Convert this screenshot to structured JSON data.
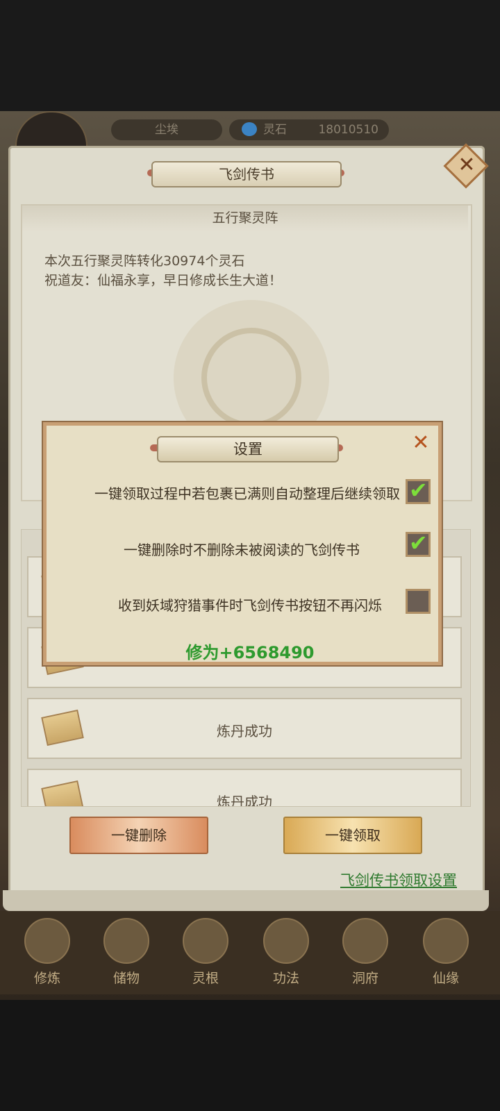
{
  "resources": {
    "dust_label": "尘埃",
    "stone_label": "灵石",
    "stone_value": "18010510"
  },
  "panel": {
    "title": "飞剑传书",
    "mail_subject": "五行聚灵阵",
    "mail_line1": "本次五行聚灵阵转化30974个灵石",
    "mail_line2": "祝道友：仙福永享，早日修成长生大道！"
  },
  "list": {
    "items": [
      {
        "label": "炼丹成功"
      },
      {
        "label": "炼丹成功"
      }
    ]
  },
  "buttons": {
    "delete_all": "一键删除",
    "collect_all": "一键领取",
    "settings_link": "飞剑传书领取设置"
  },
  "nav": {
    "items": [
      {
        "label": "修炼"
      },
      {
        "label": "储物"
      },
      {
        "label": "灵根"
      },
      {
        "label": "功法"
      },
      {
        "label": "洞府"
      },
      {
        "label": "仙缘"
      }
    ]
  },
  "dialog": {
    "title": "设置",
    "options": [
      {
        "label": "一键领取过程中若包裹已满则自动整理后继续领取",
        "checked": true
      },
      {
        "label": "一键删除时不删除未被阅读的飞剑传书",
        "checked": true
      },
      {
        "label": "收到妖域狩猎事件时飞剑传书按钮不再闪烁",
        "checked": false
      }
    ],
    "check_mark": "✔",
    "reward_text": "修为+6568490",
    "close_symbol": "✕"
  },
  "colors": {
    "reward_green": "#2e9a2e",
    "check_green": "#7dde3a",
    "link_green": "#2f7a2f"
  }
}
